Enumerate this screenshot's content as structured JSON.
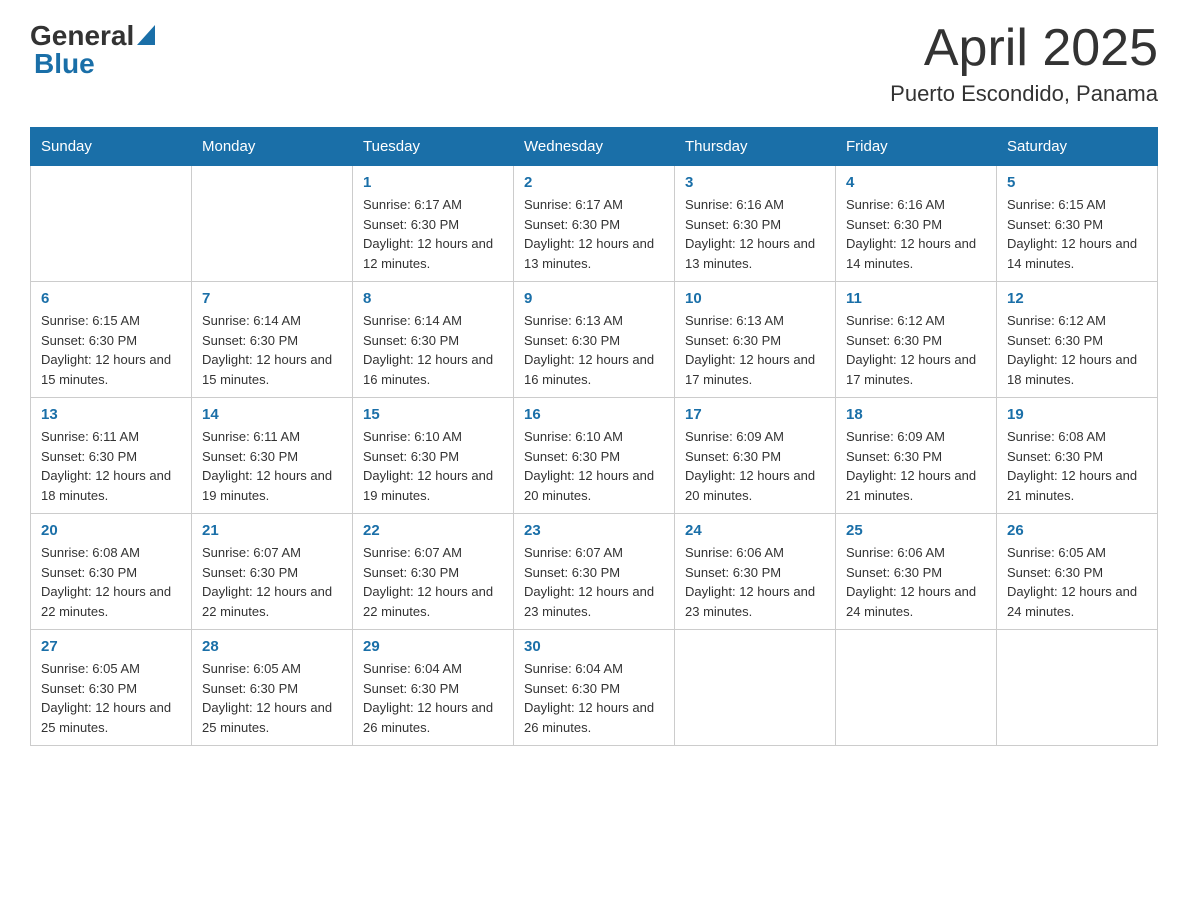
{
  "header": {
    "title": "April 2025",
    "subtitle": "Puerto Escondido, Panama",
    "logo_general": "General",
    "logo_blue": "Blue"
  },
  "days_of_week": [
    "Sunday",
    "Monday",
    "Tuesday",
    "Wednesday",
    "Thursday",
    "Friday",
    "Saturday"
  ],
  "weeks": [
    [
      {
        "day": "",
        "sunrise": "",
        "sunset": "",
        "daylight": ""
      },
      {
        "day": "",
        "sunrise": "",
        "sunset": "",
        "daylight": ""
      },
      {
        "day": "1",
        "sunrise": "Sunrise: 6:17 AM",
        "sunset": "Sunset: 6:30 PM",
        "daylight": "Daylight: 12 hours and 12 minutes."
      },
      {
        "day": "2",
        "sunrise": "Sunrise: 6:17 AM",
        "sunset": "Sunset: 6:30 PM",
        "daylight": "Daylight: 12 hours and 13 minutes."
      },
      {
        "day": "3",
        "sunrise": "Sunrise: 6:16 AM",
        "sunset": "Sunset: 6:30 PM",
        "daylight": "Daylight: 12 hours and 13 minutes."
      },
      {
        "day": "4",
        "sunrise": "Sunrise: 6:16 AM",
        "sunset": "Sunset: 6:30 PM",
        "daylight": "Daylight: 12 hours and 14 minutes."
      },
      {
        "day": "5",
        "sunrise": "Sunrise: 6:15 AM",
        "sunset": "Sunset: 6:30 PM",
        "daylight": "Daylight: 12 hours and 14 minutes."
      }
    ],
    [
      {
        "day": "6",
        "sunrise": "Sunrise: 6:15 AM",
        "sunset": "Sunset: 6:30 PM",
        "daylight": "Daylight: 12 hours and 15 minutes."
      },
      {
        "day": "7",
        "sunrise": "Sunrise: 6:14 AM",
        "sunset": "Sunset: 6:30 PM",
        "daylight": "Daylight: 12 hours and 15 minutes."
      },
      {
        "day": "8",
        "sunrise": "Sunrise: 6:14 AM",
        "sunset": "Sunset: 6:30 PM",
        "daylight": "Daylight: 12 hours and 16 minutes."
      },
      {
        "day": "9",
        "sunrise": "Sunrise: 6:13 AM",
        "sunset": "Sunset: 6:30 PM",
        "daylight": "Daylight: 12 hours and 16 minutes."
      },
      {
        "day": "10",
        "sunrise": "Sunrise: 6:13 AM",
        "sunset": "Sunset: 6:30 PM",
        "daylight": "Daylight: 12 hours and 17 minutes."
      },
      {
        "day": "11",
        "sunrise": "Sunrise: 6:12 AM",
        "sunset": "Sunset: 6:30 PM",
        "daylight": "Daylight: 12 hours and 17 minutes."
      },
      {
        "day": "12",
        "sunrise": "Sunrise: 6:12 AM",
        "sunset": "Sunset: 6:30 PM",
        "daylight": "Daylight: 12 hours and 18 minutes."
      }
    ],
    [
      {
        "day": "13",
        "sunrise": "Sunrise: 6:11 AM",
        "sunset": "Sunset: 6:30 PM",
        "daylight": "Daylight: 12 hours and 18 minutes."
      },
      {
        "day": "14",
        "sunrise": "Sunrise: 6:11 AM",
        "sunset": "Sunset: 6:30 PM",
        "daylight": "Daylight: 12 hours and 19 minutes."
      },
      {
        "day": "15",
        "sunrise": "Sunrise: 6:10 AM",
        "sunset": "Sunset: 6:30 PM",
        "daylight": "Daylight: 12 hours and 19 minutes."
      },
      {
        "day": "16",
        "sunrise": "Sunrise: 6:10 AM",
        "sunset": "Sunset: 6:30 PM",
        "daylight": "Daylight: 12 hours and 20 minutes."
      },
      {
        "day": "17",
        "sunrise": "Sunrise: 6:09 AM",
        "sunset": "Sunset: 6:30 PM",
        "daylight": "Daylight: 12 hours and 20 minutes."
      },
      {
        "day": "18",
        "sunrise": "Sunrise: 6:09 AM",
        "sunset": "Sunset: 6:30 PM",
        "daylight": "Daylight: 12 hours and 21 minutes."
      },
      {
        "day": "19",
        "sunrise": "Sunrise: 6:08 AM",
        "sunset": "Sunset: 6:30 PM",
        "daylight": "Daylight: 12 hours and 21 minutes."
      }
    ],
    [
      {
        "day": "20",
        "sunrise": "Sunrise: 6:08 AM",
        "sunset": "Sunset: 6:30 PM",
        "daylight": "Daylight: 12 hours and 22 minutes."
      },
      {
        "day": "21",
        "sunrise": "Sunrise: 6:07 AM",
        "sunset": "Sunset: 6:30 PM",
        "daylight": "Daylight: 12 hours and 22 minutes."
      },
      {
        "day": "22",
        "sunrise": "Sunrise: 6:07 AM",
        "sunset": "Sunset: 6:30 PM",
        "daylight": "Daylight: 12 hours and 22 minutes."
      },
      {
        "day": "23",
        "sunrise": "Sunrise: 6:07 AM",
        "sunset": "Sunset: 6:30 PM",
        "daylight": "Daylight: 12 hours and 23 minutes."
      },
      {
        "day": "24",
        "sunrise": "Sunrise: 6:06 AM",
        "sunset": "Sunset: 6:30 PM",
        "daylight": "Daylight: 12 hours and 23 minutes."
      },
      {
        "day": "25",
        "sunrise": "Sunrise: 6:06 AM",
        "sunset": "Sunset: 6:30 PM",
        "daylight": "Daylight: 12 hours and 24 minutes."
      },
      {
        "day": "26",
        "sunrise": "Sunrise: 6:05 AM",
        "sunset": "Sunset: 6:30 PM",
        "daylight": "Daylight: 12 hours and 24 minutes."
      }
    ],
    [
      {
        "day": "27",
        "sunrise": "Sunrise: 6:05 AM",
        "sunset": "Sunset: 6:30 PM",
        "daylight": "Daylight: 12 hours and 25 minutes."
      },
      {
        "day": "28",
        "sunrise": "Sunrise: 6:05 AM",
        "sunset": "Sunset: 6:30 PM",
        "daylight": "Daylight: 12 hours and 25 minutes."
      },
      {
        "day": "29",
        "sunrise": "Sunrise: 6:04 AM",
        "sunset": "Sunset: 6:30 PM",
        "daylight": "Daylight: 12 hours and 26 minutes."
      },
      {
        "day": "30",
        "sunrise": "Sunrise: 6:04 AM",
        "sunset": "Sunset: 6:30 PM",
        "daylight": "Daylight: 12 hours and 26 minutes."
      },
      {
        "day": "",
        "sunrise": "",
        "sunset": "",
        "daylight": ""
      },
      {
        "day": "",
        "sunrise": "",
        "sunset": "",
        "daylight": ""
      },
      {
        "day": "",
        "sunrise": "",
        "sunset": "",
        "daylight": ""
      }
    ]
  ]
}
